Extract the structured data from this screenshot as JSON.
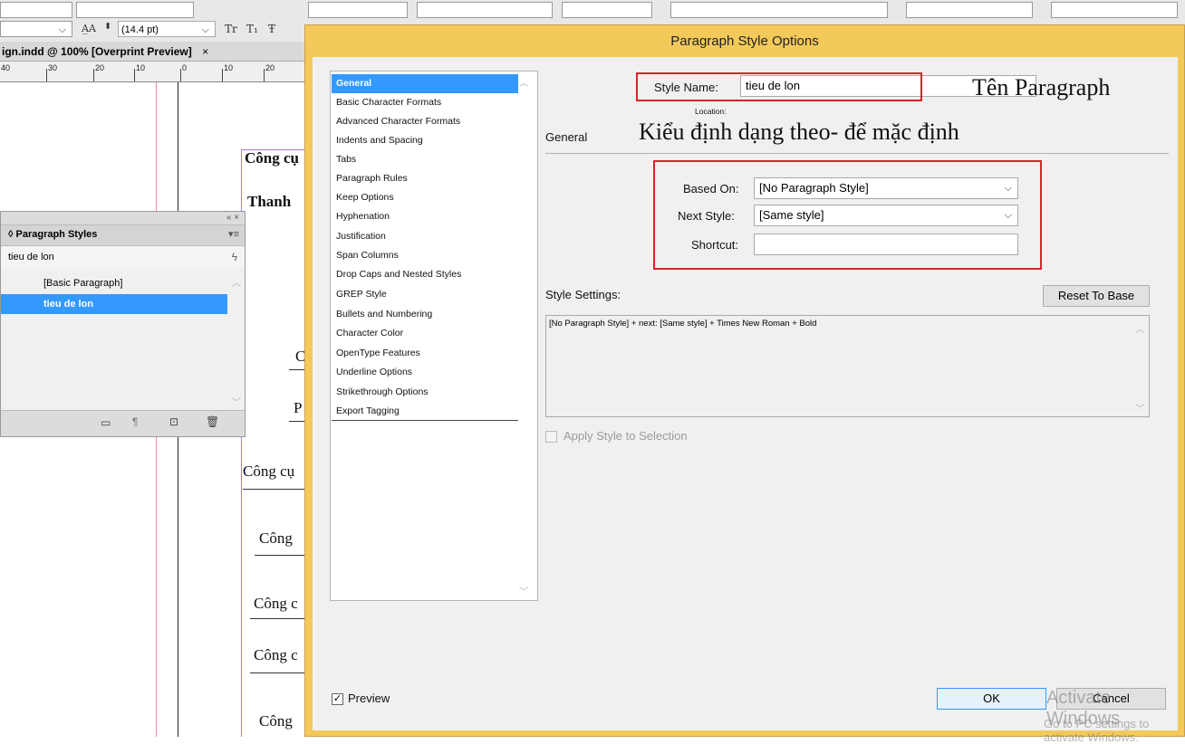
{
  "toolbar": {
    "leading_value": "(14.4 pt)",
    "font_style_glyphs": [
      "Tr",
      "T₁",
      "Ŧ"
    ]
  },
  "document": {
    "tab_title": "ign.indd @ 100% [Overprint Preview]",
    "tab_close": "×",
    "ruler_numbers": [
      "40",
      "30",
      "20",
      "10",
      "0",
      "10",
      "20"
    ],
    "text_lines": [
      "Công cụ",
      "Thanh",
      "C",
      "P",
      "Công cụ",
      "Công",
      "Công c",
      "Công c",
      "Công"
    ]
  },
  "paragraph_panel": {
    "title": "◊ Paragraph Styles",
    "current_style": "tieu de lon",
    "collapse_glyphs": "« ×",
    "items": [
      {
        "label": "[Basic Paragraph]",
        "selected": false
      },
      {
        "label": "tieu de lon",
        "selected": true
      }
    ],
    "bottom_icons": [
      "folder-icon",
      "pilcrow-icon",
      "new-style-icon",
      "trash-icon"
    ]
  },
  "dialog": {
    "title": "Paragraph Style Options",
    "categories": [
      "General",
      "Basic Character Formats",
      "Advanced Character Formats",
      "Indents and Spacing",
      "Tabs",
      "Paragraph Rules",
      "Keep Options",
      "Hyphenation",
      "Justification",
      "Span Columns",
      "Drop Caps and Nested Styles",
      "GREP Style",
      "Bullets and Numbering",
      "Character Color",
      "OpenType Features",
      "Underline Options",
      "Strikethrough Options",
      "Export Tagging"
    ],
    "selected_category": "General",
    "style_name_label": "Style Name:",
    "style_name_value": "tieu de lon",
    "location_label": "Location:",
    "section_heading": "General",
    "based_on_label": "Based On:",
    "based_on_value": "[No Paragraph Style]",
    "next_style_label": "Next Style:",
    "next_style_value": "[Same style]",
    "shortcut_label": "Shortcut:",
    "shortcut_value": "",
    "style_settings_label": "Style Settings:",
    "reset_button": "Reset To Base",
    "style_settings_text": "[No Paragraph Style] + next: [Same style] + Times New Roman + Bold",
    "apply_label": "Apply Style to Selection",
    "apply_checked": false,
    "preview_label": "Preview",
    "preview_checked": true,
    "ok_button": "OK",
    "cancel_button": "Cancel"
  },
  "annotations": {
    "name_note": "Tên Paragraph",
    "based_note": "Kiểu định dạng theo- để mặc định"
  },
  "watermark": {
    "line1": "Activate Windows",
    "line2": "Go to PC settings to activate Windows."
  },
  "colors": {
    "dialog_frame": "#f3c95a",
    "selection": "#3399ff",
    "annotation_box": "#d8222a"
  }
}
